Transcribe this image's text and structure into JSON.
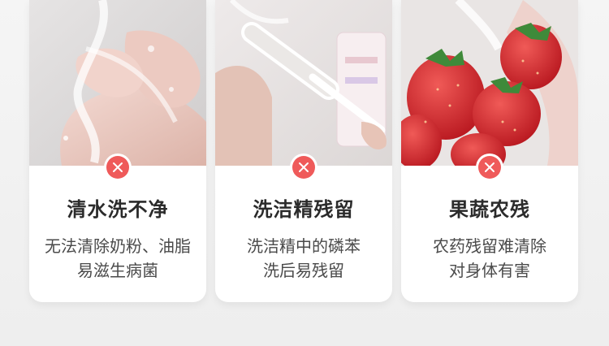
{
  "cards": [
    {
      "image": "hands-washing-under-running-water",
      "badge_icon": "close-icon",
      "title": "清水洗不净",
      "desc_line1": "无法清除奶粉、油脂",
      "desc_line2": "易滋生病菌"
    },
    {
      "image": "bottle-brush-cleaning-baby-bottle",
      "badge_icon": "close-icon",
      "title": "洗洁精残留",
      "desc_line1": "洗洁精中的磷苯",
      "desc_line2": "洗后易残留"
    },
    {
      "image": "strawberries-rinsed-under-water",
      "badge_icon": "close-icon",
      "title": "果蔬农残",
      "desc_line1": "农药残留难清除",
      "desc_line2": "对身体有害"
    }
  ],
  "colors": {
    "badge": "#ef5a5a",
    "title": "#2b2b2b",
    "text": "#4a4a4a",
    "background": "#f1f1f1"
  }
}
